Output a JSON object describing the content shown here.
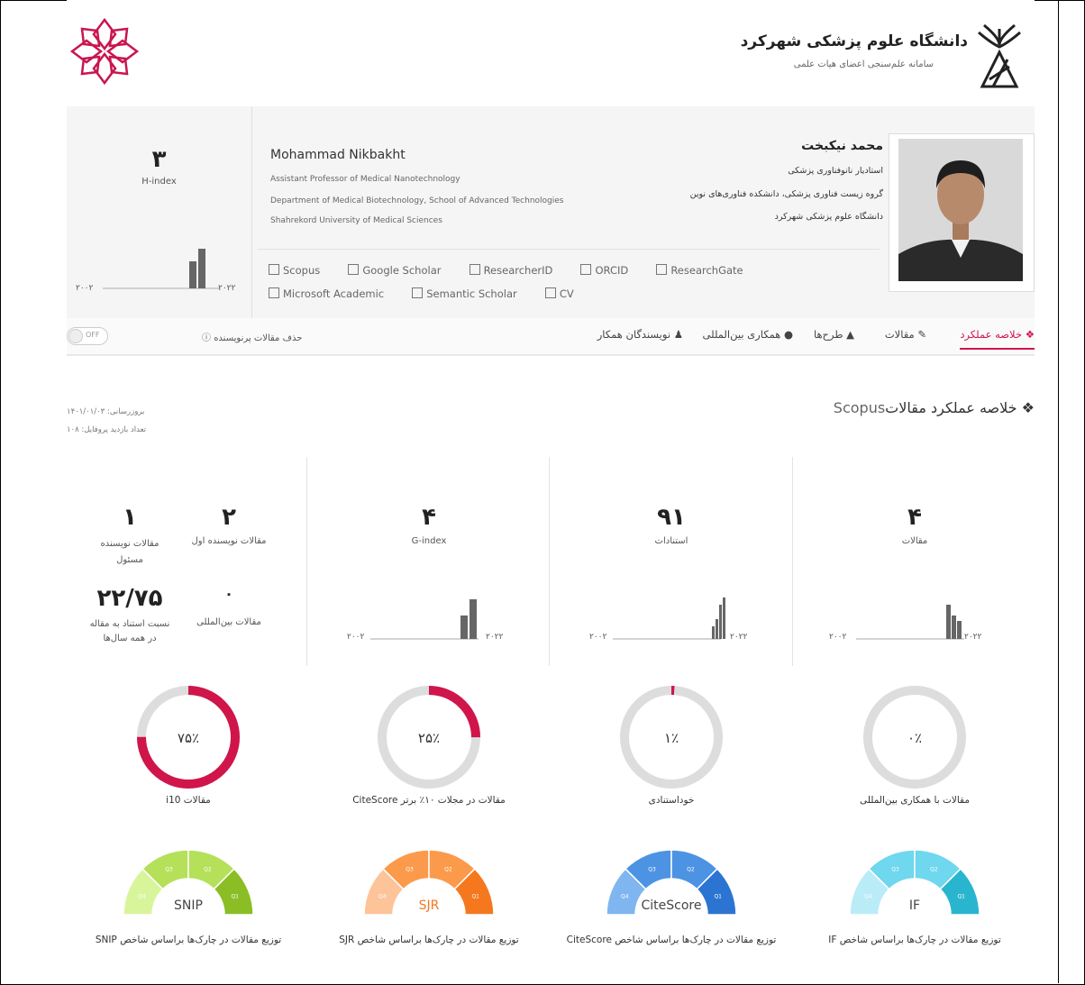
{
  "corner_text": "en",
  "header": {
    "university_title": "دانشگاه علوم پزشکی شهرکرد",
    "university_subtitle": "سامانه علم‌سنجی اعضای هیات علمی"
  },
  "profile": {
    "hindex_value": "۳",
    "hindex_label": "H-index",
    "chart_start": "۲۰۰۲",
    "chart_end": "۲۰۲۲",
    "name_en": "Mohammad Nikbakht",
    "title_en": "Assistant Professor of Medical Nanotechnology",
    "dept_en": "Department of Medical Biotechnology, School of Advanced Technologies",
    "univ_en": "Shahrekord University of Medical Sciences",
    "name_fa": "محمد نیکبخت",
    "title_fa": "استادیار نانوفناوری پزشکی",
    "dept_fa": "گروه زیست فناوری پزشکی، دانشکده فناوری‌های نوین",
    "univ_fa": "دانشگاه علوم پزشکی شهرکرد",
    "links": [
      "Scopus",
      "Google Scholar",
      "ResearcherID",
      "ORCID",
      "ResearchGate",
      "Microsoft Academic",
      "Semantic Scholar",
      "CV"
    ]
  },
  "nav": {
    "tabs": [
      "خلاصه عملکرد",
      "مقالات",
      "طرح‌ها",
      "همکاری بین‌المللی",
      "نویسندگان همکار"
    ],
    "toggle_label": "حذف مقالات پرنویسنده",
    "toggle_state": "OFF"
  },
  "summary": {
    "title": "خلاصه عملکرد مقالات",
    "title_source": "Scopus",
    "updated": "بروزرسانی: ۱۴۰۱/۰۱/۰۳",
    "visits": "تعداد بازدید پروفایل: ۱۰۸",
    "stats": {
      "articles_value": "۴",
      "articles_label": "مقالات",
      "citations_value": "۹۱",
      "citations_label": "استنادات",
      "gindex_value": "۴",
      "gindex_label": "G-index",
      "first_author_value": "۲",
      "first_author_label": "مقالات نویسنده اول",
      "corresponding_value": "۱",
      "corresponding_label": "مقالات نویسنده مسئول",
      "intl_value": "۰",
      "intl_label": "مقالات بین‌المللی",
      "ratio_value": "۲۲/۷۵",
      "ratio_label": "نسبت استناد به مقاله در همه سال‌ها",
      "chart_start": "۲۰۰۲",
      "chart_end": "۲۰۲۲"
    },
    "donuts": [
      {
        "value": "۰٪",
        "fraction": 0.0,
        "label": "مقالات با همکاری بین‌المللی"
      },
      {
        "value": "۱٪",
        "fraction": 0.01,
        "label": "خوداستنادی"
      },
      {
        "value": "۲۵٪",
        "fraction": 0.25,
        "label": "مقالات در مجلات ۱۰٪ برتر CiteScore"
      },
      {
        "value": "۷۵٪",
        "fraction": 0.75,
        "label": "مقالات i10"
      }
    ],
    "gauges": [
      {
        "name": "IF",
        "label": "توزیع مقالات در چارک‌ها براساس شاخص IF",
        "colors": [
          "#b9ecf6",
          "#6fd7ee",
          "#2ab5cf"
        ]
      },
      {
        "name": "CiteScore",
        "label": "توزیع مقالات در چارک‌ها براساس شاخص CiteScore",
        "colors": [
          "#7fb6ef",
          "#4c93e4",
          "#2c74d2"
        ]
      },
      {
        "name": "SJR",
        "label": "توزیع مقالات در چارک‌ها براساس شاخص SJR",
        "colors": [
          "#fdc399",
          "#fb9a4b",
          "#f5781f"
        ]
      },
      {
        "name": "SNIP",
        "label": "توزیع مقالات در چارک‌ها براساس شاخص SNIP",
        "colors": [
          "#d9f59b",
          "#b5e05a",
          "#8bbe25"
        ]
      }
    ],
    "gauge_quartiles": [
      "Q4",
      "Q3",
      "Q2",
      "Q1"
    ]
  },
  "colors": {
    "accent": "#d0154b",
    "bar": "#666666",
    "donut_track": "#dddddd"
  }
}
